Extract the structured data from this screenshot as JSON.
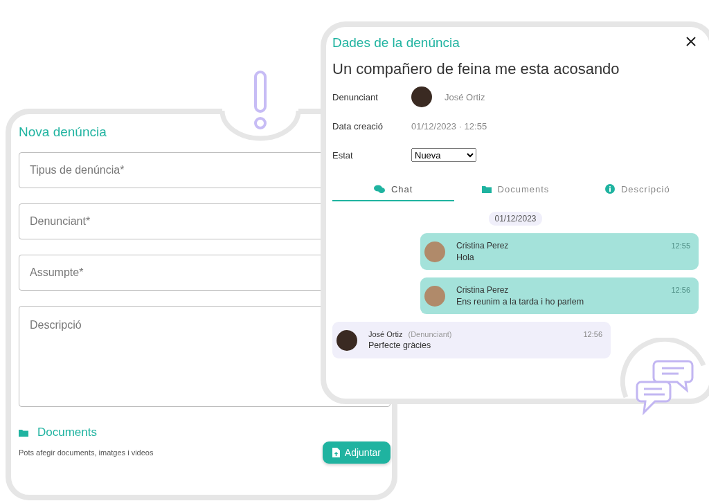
{
  "new_report": {
    "title": "Nova denúncia",
    "fields": [
      {
        "kind": "input",
        "placeholder": "Tipus de denúncia*"
      },
      {
        "kind": "input",
        "placeholder": "Denunciant*"
      },
      {
        "kind": "input",
        "placeholder": "Assumpte*"
      },
      {
        "kind": "textarea",
        "placeholder": "Descripció"
      }
    ],
    "documents": {
      "title": "Documents",
      "hint": "Pots afegir documents, imatges i videos",
      "button": "Adjuntar"
    }
  },
  "details": {
    "title": "Dades de la denúncia",
    "subject": "Un compañero de feina me esta acosando",
    "rows": [
      {
        "kind": "person",
        "label": "Denunciant",
        "value": "José Ortiz"
      },
      {
        "kind": "text",
        "label": "Data creació",
        "value": "01/12/2023 · 12:55"
      },
      {
        "kind": "select",
        "label": "Estat",
        "value": "Nueva"
      }
    ],
    "tabs": [
      {
        "label": "Chat",
        "selected": true
      },
      {
        "label": "Documents",
        "selected": false
      },
      {
        "label": "Descripció",
        "selected": false
      }
    ],
    "chat": {
      "date": "01/12/2023",
      "messages": [
        {
          "kind": "own",
          "author": "Cristina Perez",
          "text": "Hola",
          "time": "12:55"
        },
        {
          "kind": "own",
          "author": "Cristina Perez",
          "text": "Ens reunim a la tarda i ho parlem",
          "time": "12:56"
        },
        {
          "kind": "other",
          "author": "José Ortiz",
          "role": "(Denunciant)",
          "text": "Perfecte gràcies",
          "time": "12:56"
        }
      ]
    }
  }
}
